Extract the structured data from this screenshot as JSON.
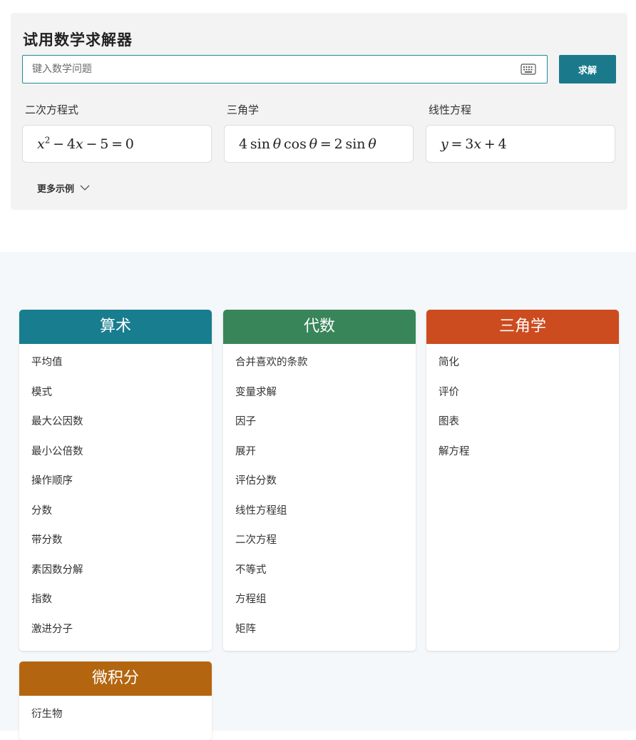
{
  "solver": {
    "title": "试用数学求解器",
    "input_placeholder": "键入数学问题",
    "solve_label": "求解",
    "keyboard_icon": "keyboard-icon",
    "examples": [
      {
        "label": "二次方程式",
        "expression": "x^2 - 4x - 5 = 0"
      },
      {
        "label": "三角学",
        "expression": "4 sin θ cos θ = 2 sin θ"
      },
      {
        "label": "线性方程",
        "expression": "y = 3x + 4"
      }
    ],
    "more_label": "更多示例",
    "more_icon": "chevron-down-icon"
  },
  "categories": [
    {
      "title": "算术",
      "color": "#177d8f",
      "items": [
        "平均值",
        "模式",
        "最大公因数",
        "最小公倍数",
        "操作顺序",
        "分数",
        "带分数",
        "素因数分解",
        "指数",
        "激进分子"
      ]
    },
    {
      "title": "代数",
      "color": "#39855a",
      "items": [
        "合并喜欢的条款",
        "变量求解",
        "因子",
        "展开",
        "评估分数",
        "线性方程组",
        "二次方程",
        "不等式",
        "方程组",
        "矩阵"
      ]
    },
    {
      "title": "三角学",
      "color": "#cc4c1f",
      "items": [
        "简化",
        "评价",
        "图表",
        "解方程"
      ]
    },
    {
      "title": "微积分",
      "color": "#b3660f",
      "items": [
        "衍生物"
      ]
    }
  ]
}
